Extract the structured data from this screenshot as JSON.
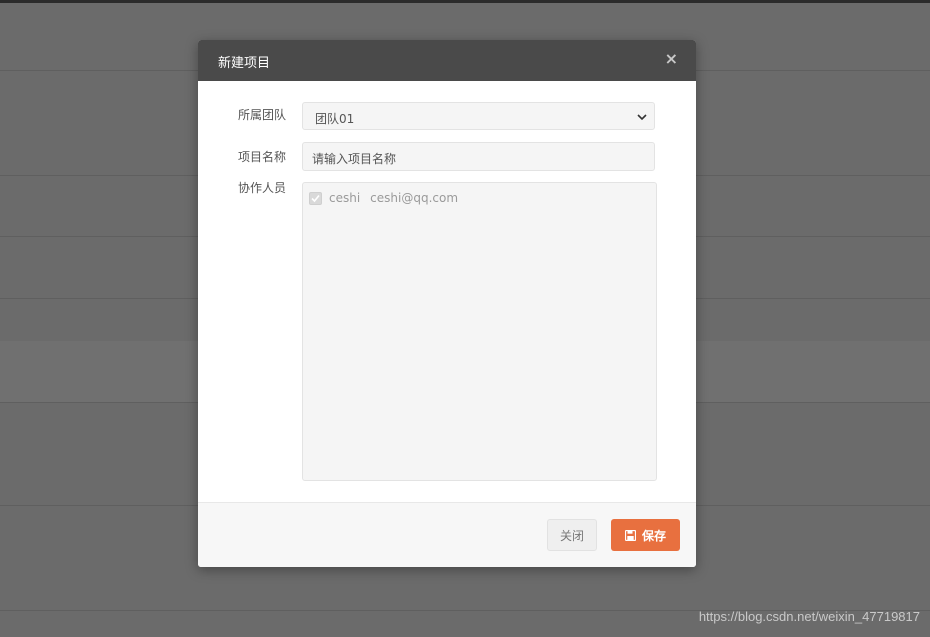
{
  "modal": {
    "title": "新建项目",
    "close_glyph": "×"
  },
  "form": {
    "team_label": "所属团队",
    "team_selected": "团队01",
    "project_name_label": "项目名称",
    "project_name_value": "请输入项目名称",
    "collaborators_label": "协作人员",
    "collaborators": [
      {
        "name": "ceshi",
        "email": "ceshi@qq.com",
        "checked": true
      }
    ]
  },
  "footer": {
    "close_label": "关闭",
    "save_label": "保存"
  },
  "watermark": "https://blog.csdn.net/weixin_47719817",
  "colors": {
    "header_bg": "#4a4a4a",
    "save_button": "#e8703f",
    "backdrop": "#6b6b6b"
  },
  "icons": {
    "close": "close-icon",
    "chevron": "chevron-down-icon",
    "checkbox": "check-icon",
    "save": "floppy-disk-icon"
  }
}
